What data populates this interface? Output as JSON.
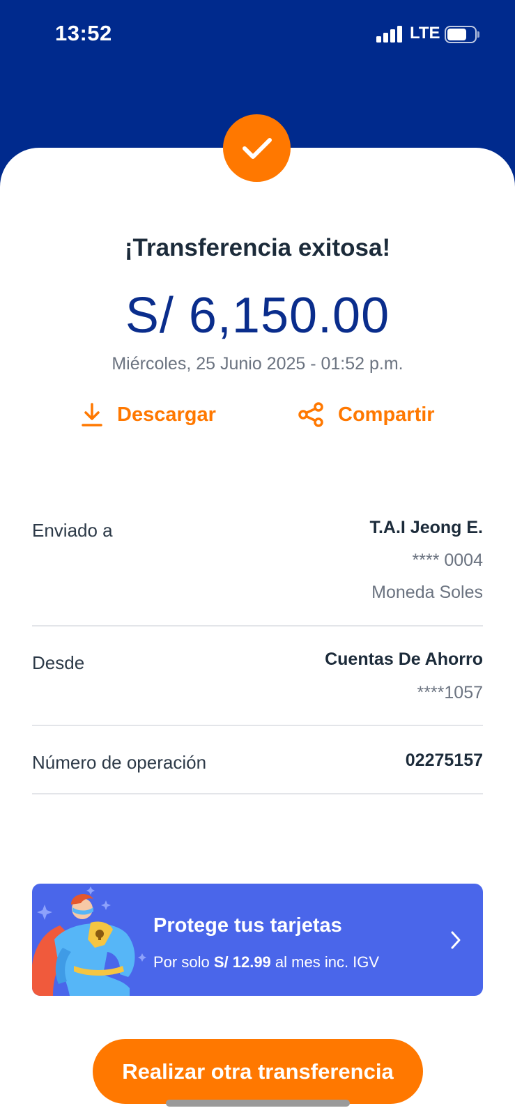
{
  "status_bar": {
    "time": "13:52",
    "network": "LTE",
    "battery_level": 0.7
  },
  "result": {
    "title": "¡Transferencia exitosa!",
    "amount": "S/ 6,150.00",
    "date": "Miércoles, 25 Junio 2025 - 01:52 p.m.",
    "status_icon": "checkmark-icon"
  },
  "actions": {
    "download_label": "Descargar",
    "download_icon": "download-icon",
    "share_label": "Compartir",
    "share_icon": "share-icon"
  },
  "details": {
    "sent_to": {
      "label": "Enviado a",
      "name": "T.A.I Jeong E.",
      "account": "**** 0004",
      "currency": "Moneda Soles"
    },
    "from": {
      "label": "Desde",
      "account_type": "Cuentas De Ahorro",
      "account": "****1057"
    },
    "operation": {
      "label": "Número de operación",
      "number": "02275157"
    }
  },
  "promo": {
    "title": "Protege tus tarjetas",
    "sub_prefix": "Por solo",
    "price": "S/ 12.99",
    "sub_suffix": "al mes inc. IGV"
  },
  "cta": {
    "label": "Realizar otra transferencia"
  },
  "colors": {
    "header_blue": "#002a8d",
    "amount_blue": "#0a2d8c",
    "accent_orange": "#ff7800",
    "promo_blue": "#4a66ea"
  }
}
